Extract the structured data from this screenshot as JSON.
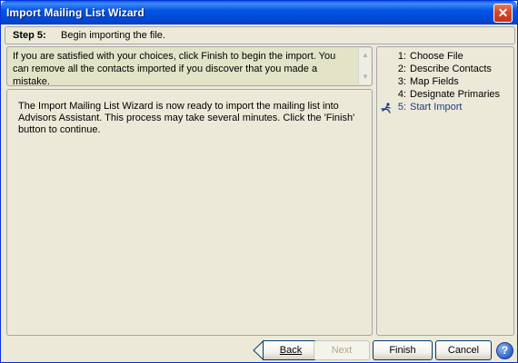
{
  "window": {
    "title": "Import Mailing List Wizard",
    "close_glyph": "✕",
    "accent_color": "#0554e3"
  },
  "step_header": {
    "label": "Step 5:",
    "description": "Begin importing the file."
  },
  "info": {
    "text": "If you are satisfied with your choices, click Finish to begin the import.  You can remove all the contacts imported if you discover that you made a mistake."
  },
  "main": {
    "text": "The Import Mailing List Wizard is now ready to import the mailing list into Advisors Assistant.  This process may take several minutes.  Click the 'Finish' button to continue."
  },
  "steps": [
    {
      "num": "1:",
      "label": "Choose File",
      "current": false
    },
    {
      "num": "2:",
      "label": "Describe Contacts",
      "current": false
    },
    {
      "num": "3:",
      "label": "Map Fields",
      "current": false
    },
    {
      "num": "4:",
      "label": "Designate Primaries",
      "current": false
    },
    {
      "num": "5:",
      "label": "Start Import",
      "current": true,
      "icon": "runner-icon"
    }
  ],
  "buttons": {
    "back_label": "Back",
    "next_label": "Next",
    "finish_label": "Finish",
    "cancel_label": "Cancel",
    "help_glyph": "?"
  }
}
